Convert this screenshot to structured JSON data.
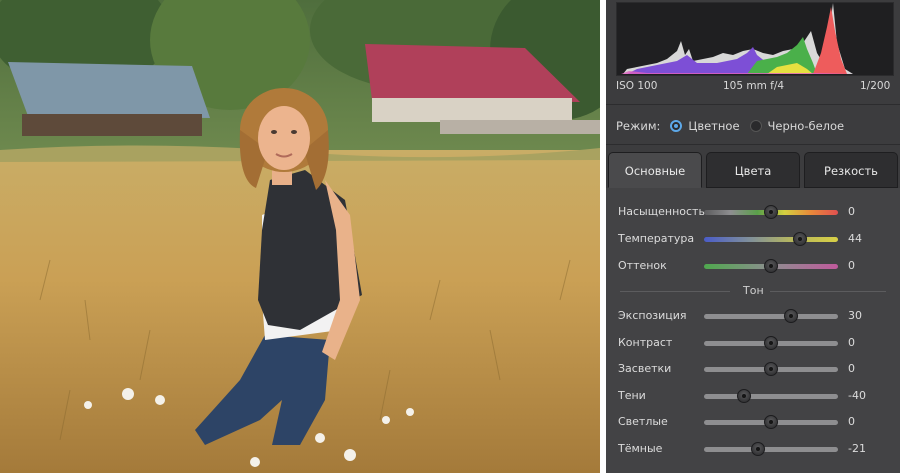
{
  "photo": {
    "description_icon": "field-portrait-photo"
  },
  "histogram": {
    "iso": "ISO 100",
    "lens": "105 mm f/4",
    "shutter": "1/200"
  },
  "mode": {
    "label": "Режим:",
    "options": [
      {
        "label": "Цветное",
        "selected": true
      },
      {
        "label": "Черно-белое",
        "selected": false
      }
    ]
  },
  "tabs": [
    {
      "label": "Основные",
      "active": true
    },
    {
      "label": "Цвета",
      "active": false
    },
    {
      "label": "Резкость",
      "active": false
    }
  ],
  "color_sliders": [
    {
      "label": "Насыщенность",
      "value": "0",
      "position": 0.5,
      "gradient": [
        "#5c5c5e",
        "#8e8e90",
        "#5aa04a",
        "#d4d040",
        "#e8883a",
        "#e05050"
      ]
    },
    {
      "label": "Температура",
      "value": "44",
      "position": 0.72,
      "gradient": [
        "#4a5cc8",
        "#7f8f9c",
        "#b8b85c",
        "#d8d046"
      ]
    },
    {
      "label": "Оттенок",
      "value": "0",
      "position": 0.5,
      "gradient": [
        "#4fa84e",
        "#8e8e90",
        "#c05a9c"
      ]
    }
  ],
  "tone_section": {
    "title": "Тон"
  },
  "tone_sliders": [
    {
      "label": "Экспозиция",
      "value": "30",
      "position": 0.65
    },
    {
      "label": "Контраст",
      "value": "0",
      "position": 0.5
    },
    {
      "label": "Засветки",
      "value": "0",
      "position": 0.5
    },
    {
      "label": "Тени",
      "value": "-40",
      "position": 0.3
    },
    {
      "label": "Светлые",
      "value": "0",
      "position": 0.5
    },
    {
      "label": "Тёмные",
      "value": "-21",
      "position": 0.4
    }
  ]
}
